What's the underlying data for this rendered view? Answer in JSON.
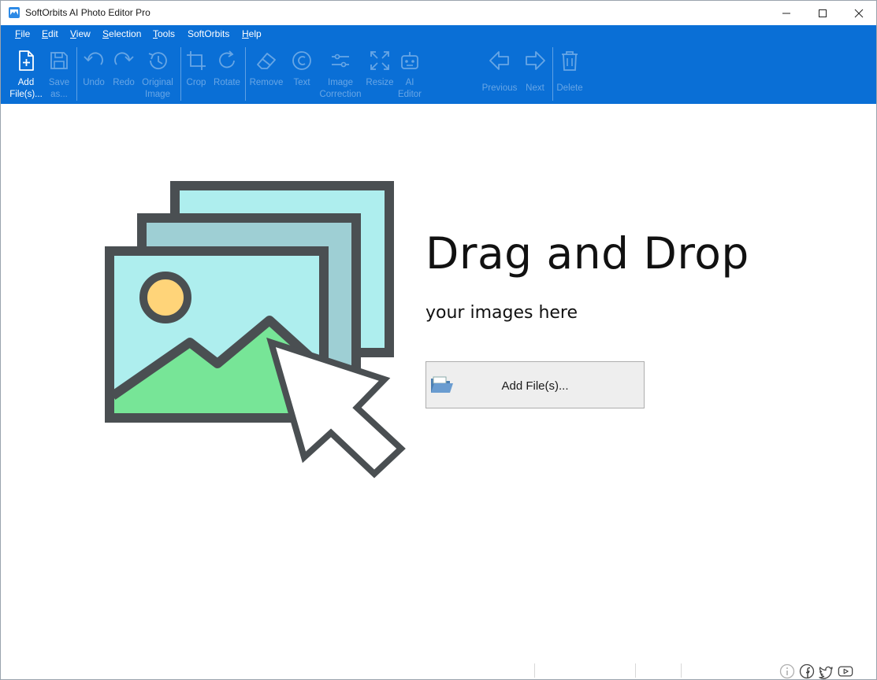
{
  "window": {
    "title": "SoftOrbits AI Photo Editor Pro",
    "controls": [
      "minimize",
      "maximize",
      "close"
    ]
  },
  "menu": [
    {
      "label": "File",
      "accel": "F",
      "rest": "ile"
    },
    {
      "label": "Edit",
      "accel": "E",
      "rest": "dit"
    },
    {
      "label": "View",
      "accel": "V",
      "rest": "iew"
    },
    {
      "label": "Selection",
      "accel": "S",
      "rest": "election"
    },
    {
      "label": "Tools",
      "accel": "T",
      "rest": "ools"
    },
    {
      "label": "SoftOrbits",
      "accel": "",
      "rest": "SoftOrbits"
    },
    {
      "label": "Help",
      "accel": "H",
      "rest": "elp"
    }
  ],
  "toolbar": {
    "add_files": "Add\nFile(s)...",
    "save_as": "Save\nas...",
    "undo": "Undo",
    "redo": "Redo",
    "original_image": "Original\nImage",
    "crop": "Crop",
    "rotate": "Rotate",
    "remove": "Remove",
    "text": "Text",
    "image_correction": "Image\nCorrection",
    "resize": "Resize",
    "ai_editor": "AI\nEditor",
    "previous": "Previous",
    "next": "Next",
    "delete": "Delete"
  },
  "dropzone": {
    "title": "Drag and Drop",
    "subtitle": "your images here",
    "button_label": "Add File(s)..."
  },
  "statusbar": {
    "icons": [
      "info-icon",
      "facebook-icon",
      "twitter-icon",
      "youtube-icon"
    ]
  },
  "colors": {
    "ribbon": "#0a6fd6",
    "illustration_frame": "#4a4f52",
    "sky": "#aeeeee",
    "mountain": "#77e597",
    "sun": "#ffd479"
  }
}
